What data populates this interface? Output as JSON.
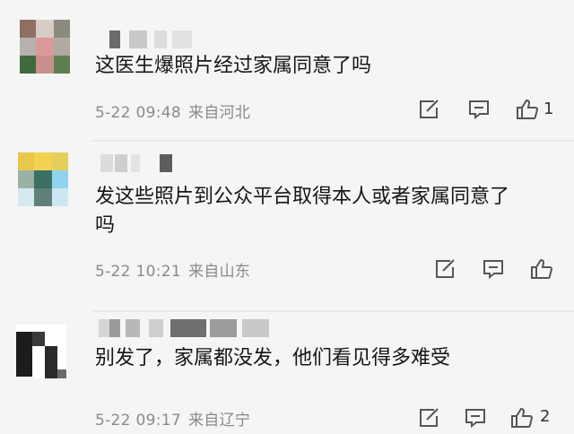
{
  "comments": [
    {
      "text": "这医生爆照片经过家属同意了吗",
      "date": "5-22 09:48",
      "location": "来自河北",
      "like_count": "1"
    },
    {
      "text": "发这些照片到公众平台取得本人或者家属同意了\n吗",
      "date": "5-22 10:21",
      "location": "来自山东",
      "like_count": ""
    },
    {
      "text": "别发了，家属都没发，他们看见得多难受",
      "date": "5-22 09:17",
      "location": "来自辽宁",
      "like_count": "2"
    }
  ],
  "icons": {
    "share": "share-icon",
    "reply": "comment-icon",
    "like": "thumbs-up-icon"
  },
  "colors": {
    "text": "#161616",
    "meta": "#8a8a8a",
    "icon": "#555555",
    "background": "#f5f5f5"
  }
}
